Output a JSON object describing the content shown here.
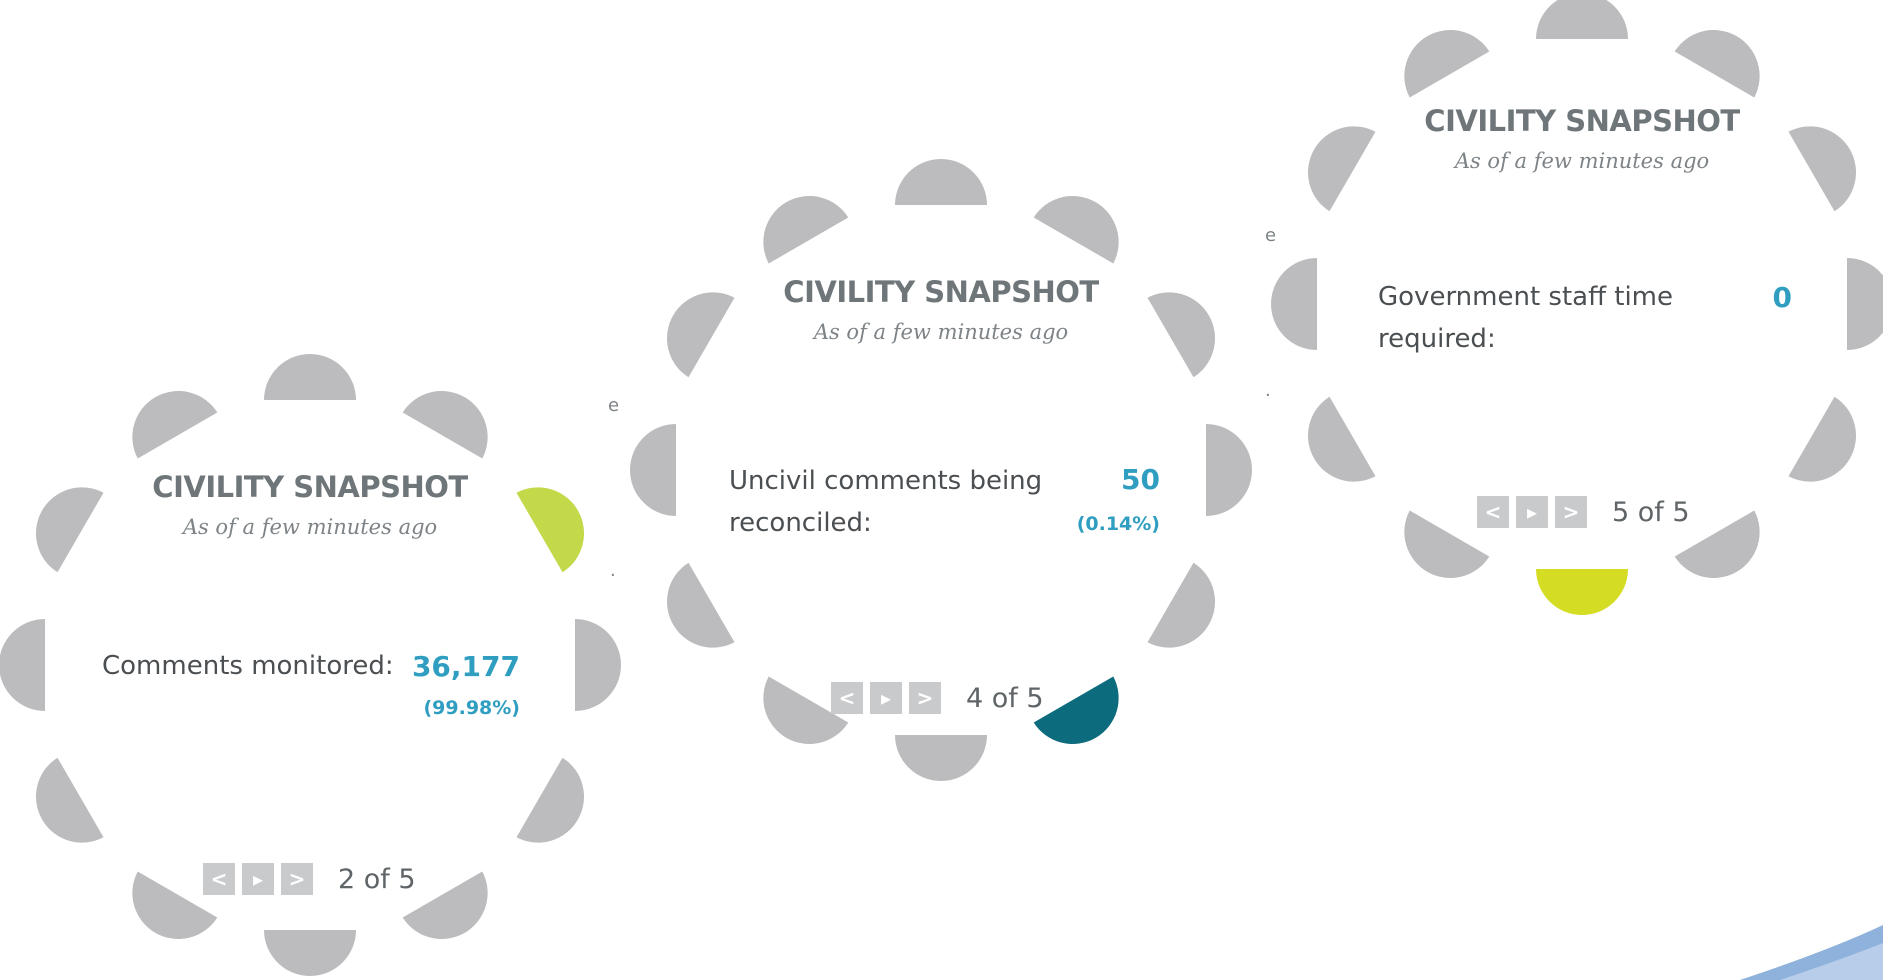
{
  "widgets": [
    {
      "title": "CIVILITY SNAPSHOT",
      "subtitle": "As of a few minutes ago",
      "label_line1": "Comments monitored:",
      "label_line2": "",
      "value": "36,177",
      "percent": "(99.98%)",
      "pager": {
        "prev": "<",
        "play": "▸",
        "next": ">",
        "count": "2 of 5"
      }
    },
    {
      "title": "CIVILITY SNAPSHOT",
      "subtitle": "As of a few minutes ago",
      "label_line1": "Uncivil comments being",
      "label_line2": "reconciled:",
      "value": "50",
      "percent": "(0.14%)",
      "pager": {
        "prev": "<",
        "play": "▸",
        "next": ">",
        "count": "4 of 5"
      }
    },
    {
      "title": "CIVILITY SNAPSHOT",
      "subtitle": "As of a few minutes ago",
      "label_line1": "Government staff time",
      "label_line2": "required:",
      "value": "0",
      "percent": "",
      "pager": {
        "prev": "<",
        "play": "▸",
        "next": ">",
        "count": "5 of 5"
      }
    }
  ],
  "colors": {
    "segment": "#bcbcbf",
    "lime": "#c3d94a",
    "teal": "#0c6b7c",
    "yellow": "#d4dc24",
    "value": "#2f9ec0",
    "pager_button": "#c9cacb"
  },
  "decor": {
    "stray_marks": [
      "e",
      ".",
      "e",
      ".",
      "."
    ]
  }
}
